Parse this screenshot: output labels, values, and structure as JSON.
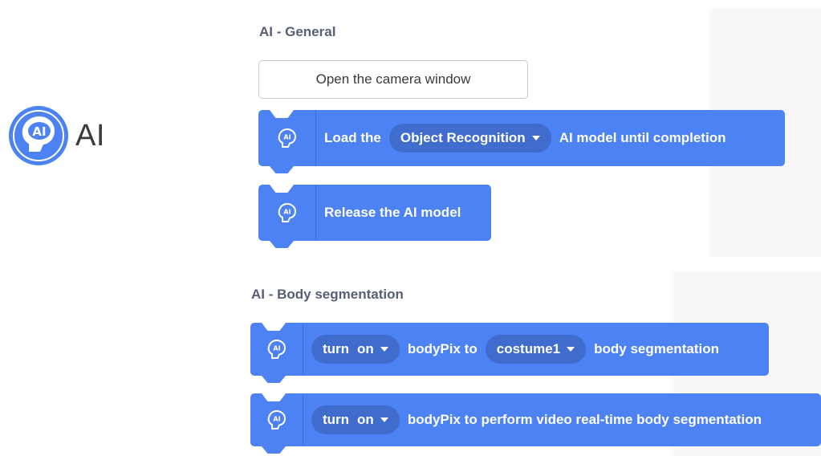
{
  "category": {
    "label": "AI",
    "icon": "ai-head-icon",
    "color": "#4c82f4"
  },
  "sections": {
    "general": {
      "title": "AI - General",
      "camera_button": "Open the camera window",
      "load_block": {
        "prefix": "Load the",
        "dropdown": "Object Recognition",
        "suffix": "AI model until completion"
      },
      "release_block": {
        "text": "Release the AI model"
      }
    },
    "body_segmentation": {
      "title": "AI - Body segmentation",
      "block1": {
        "turn_label": "turn",
        "toggle": "on",
        "middle": "bodyPix to",
        "costume": "costume1",
        "suffix": "body segmentation"
      },
      "block2": {
        "turn_label": "turn",
        "toggle": "on",
        "suffix": "bodyPix to perform video real-time body segmentation"
      }
    }
  },
  "colors": {
    "block": "#4c82f4",
    "pill": "#3f6ccd",
    "title": "#575e75"
  }
}
